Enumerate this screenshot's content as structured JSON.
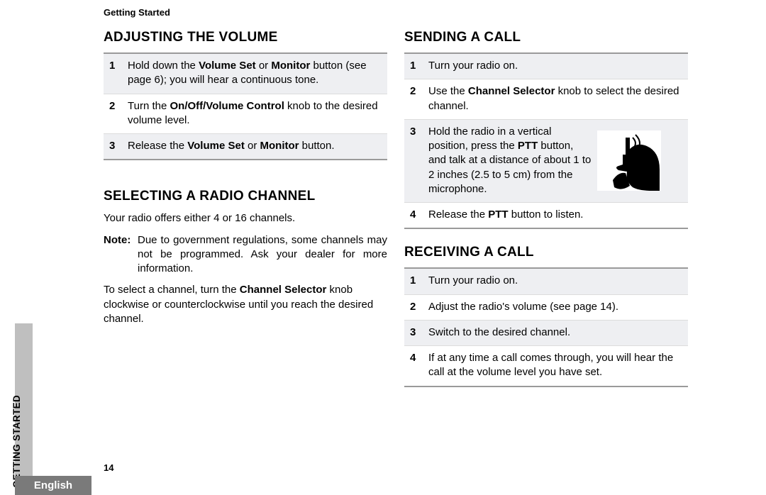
{
  "header": {
    "running_title": "Getting Started",
    "page_number": "14"
  },
  "side_tab": {
    "section": "GETTING STARTED",
    "language": "English"
  },
  "left": {
    "h1": "ADJUSTING THE VOLUME",
    "steps1": [
      {
        "n": "1",
        "pre": "Hold down the ",
        "b1": "Volume Set",
        "mid": " or ",
        "b2": "Monitor",
        "post": " button (see page 6); you will hear a continuous tone."
      },
      {
        "n": "2",
        "pre": "Turn the ",
        "b1": "On/Off/Volume Control",
        "mid": "",
        "b2": "",
        "post": " knob to the desired volume level."
      },
      {
        "n": "3",
        "pre": "Release the ",
        "b1": "Volume Set",
        "mid": " or ",
        "b2": "Monitor",
        "post": " button."
      }
    ],
    "h2": "SELECTING A RADIO CHANNEL",
    "intro": "Your radio offers either 4 or 16 channels.",
    "note_label": "Note:",
    "note_text": "Due to government regulations, some channels may not be programmed. Ask your dealer for more information.",
    "para2_pre": "To select a channel, turn the ",
    "para2_b": "Channel Selector",
    "para2_post": " knob clockwise or counterclockwise until you reach the desired channel."
  },
  "right": {
    "h1": "SENDING A CALL",
    "steps1": [
      {
        "n": "1",
        "t": "Turn your radio on."
      },
      {
        "n": "2",
        "pre": "Use the ",
        "b": "Channel Selector",
        "post": " knob to select the desired channel."
      },
      {
        "n": "3",
        "pre": "Hold the radio in a vertical position, press the ",
        "b": "PTT",
        "post": " button, and talk at a distance of about 1 to 2 inches (2.5 to 5 cm) from the microphone."
      },
      {
        "n": "4",
        "pre": "Release the ",
        "b": "PTT",
        "post": " button to listen."
      }
    ],
    "h2": "RECEIVING A CALL",
    "steps2": [
      {
        "n": "1",
        "t": "Turn your radio on."
      },
      {
        "n": "2",
        "t": "Adjust the radio's volume (see page 14)."
      },
      {
        "n": "3",
        "t": "Switch to the desired channel."
      },
      {
        "n": "4",
        "t": "If at any time a call comes through, you will hear the call at the volume level you have set."
      }
    ]
  }
}
